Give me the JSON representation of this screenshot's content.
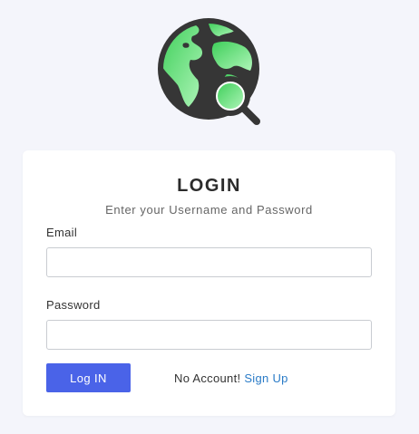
{
  "login": {
    "title": "LOGIN",
    "subtitle": "Enter your Username and Password",
    "email_label": "Email",
    "email_value": "",
    "password_label": "Password",
    "password_value": "",
    "login_button": "Log IN",
    "no_account_text": "No Account!",
    "signup_link": "Sign Up"
  },
  "logo": {
    "icon": "globe-search-icon"
  },
  "colors": {
    "background": "#f4f5fb",
    "card": "#ffffff",
    "primary_button": "#4a63e8",
    "link": "#2a7bc7",
    "globe_green": "#4fdc6a",
    "globe_dark": "#333333"
  }
}
